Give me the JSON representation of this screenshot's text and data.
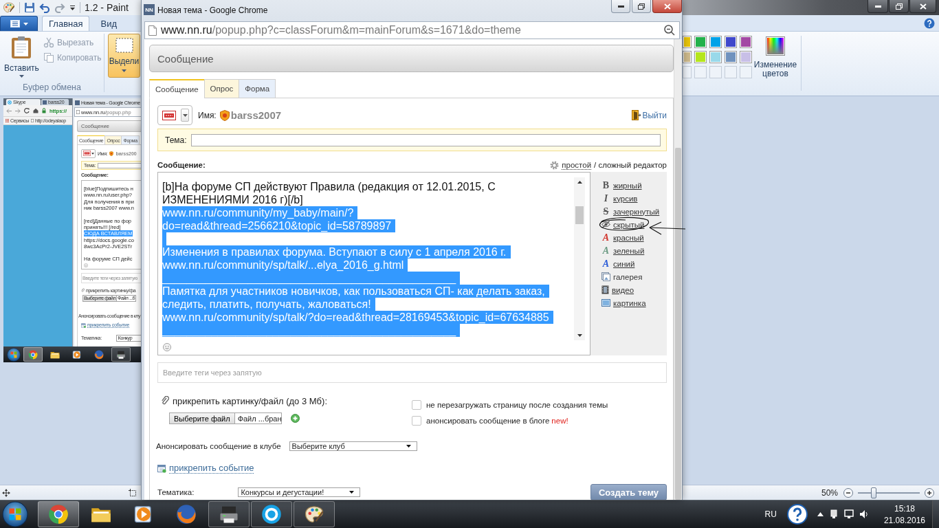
{
  "paint": {
    "title": "1.2 - Paint",
    "tabs": [
      {
        "label": "Главная",
        "selected": true
      },
      {
        "label": "Вид",
        "selected": false
      }
    ],
    "clipboard": {
      "paste": "Вставить",
      "cut": {
        "label": "Вырезать",
        "disabled": true
      },
      "copy": {
        "label": "Копировать",
        "disabled": true
      },
      "group": "Буфер обмена"
    },
    "select_tool": {
      "label": "Выдели",
      "selected": true
    },
    "palette": [
      [
        {
          "kind": "color",
          "color": "#e8c40a"
        },
        {
          "kind": "color",
          "color": "#22b14c"
        },
        {
          "kind": "color",
          "color": "#00a2e8"
        },
        {
          "kind": "color",
          "color": "#3f48cc"
        },
        {
          "kind": "color",
          "color": "#a349a4"
        }
      ],
      [
        {
          "kind": "color",
          "color": "#cdb98c"
        },
        {
          "kind": "color",
          "color": "#b5e61d"
        },
        {
          "kind": "color",
          "color": "#99d9ea"
        },
        {
          "kind": "color",
          "color": "#7092be"
        },
        {
          "kind": "color",
          "color": "#c8bfe7"
        }
      ],
      [
        {
          "kind": "empty"
        },
        {
          "kind": "empty"
        },
        {
          "kind": "empty"
        },
        {
          "kind": "empty"
        },
        {
          "kind": "empty"
        }
      ]
    ],
    "edit_colors": "Изменение цветов",
    "zoom": {
      "label": "50%",
      "level": 0.25
    }
  },
  "pasted_image": {
    "tabs": [
      {
        "label": "Skype",
        "selected": true
      },
      {
        "label": "barss20",
        "selected": false
      }
    ],
    "address": "https://",
    "bookmarks": [
      "Сервисы",
      "http://odeyalaop"
    ],
    "popup": {
      "title": "Новая тема - Google Chrome",
      "url_host": "www.nn.ru",
      "url_path": "/popup.php",
      "header": "Сообщение",
      "tabs": [
        {
          "label": "Сообщение",
          "selected": true,
          "color": "#ffffff"
        },
        {
          "label": "Опрос",
          "selected": false,
          "color": "#fdf6dc"
        },
        {
          "label": "Форма",
          "selected": false,
          "color": "#e7effa"
        }
      ],
      "name_label": "Имя:",
      "user": "barss200",
      "topic_label": "Тема:",
      "message_label": "Сообщение:",
      "lines": [
        {
          "kind": "text",
          "text": "[blue]Подпишитесь н",
          "selected": false
        },
        {
          "kind": "text",
          "text": "www.nn.ru/user.php?",
          "selected": false
        },
        {
          "kind": "text",
          "text": "Для получения в при",
          "selected": false
        },
        {
          "kind": "text",
          "text": "ник barss2007 www.n",
          "selected": false
        },
        {
          "kind": "blank",
          "selected": false
        },
        {
          "kind": "text",
          "text": "[red]Данные по фор",
          "selected": false
        },
        {
          "kind": "text",
          "text": "принять!!! [/red]",
          "selected": false
        },
        {
          "kind": "text",
          "text": "СЮДА ВСТАВЛЯЕМ",
          "selected": true
        },
        {
          "kind": "text",
          "text": "https://docs.google.co",
          "selected": false
        },
        {
          "kind": "text",
          "text": "8wc3AcPr2-JVE2STr",
          "selected": false
        },
        {
          "kind": "blank",
          "selected": false
        },
        {
          "kind": "text",
          "text": "На форуме СП дейс",
          "selected": false
        }
      ],
      "tags_placeholder": "Введите теги через запятую",
      "attach": "прикрепить картинку/фа",
      "file_button": "Выберите файл",
      "file_name": "Файл ...б",
      "club_label": "Анонсировать сообщение в клу",
      "event_link": "прикрепить событие",
      "category_label": "Тематика:",
      "category_value": "Конкур"
    },
    "taskbar": [
      {
        "kind": "chrome",
        "running": true,
        "selected": true
      },
      {
        "kind": "explorer",
        "running": false,
        "selected": false
      },
      {
        "kind": "media",
        "running": false,
        "selected": false
      },
      {
        "kind": "firefox",
        "running": false,
        "selected": false
      },
      {
        "kind": "printer",
        "running": true,
        "selected": false
      }
    ]
  },
  "popup": {
    "logo": "NN",
    "title": "Новая тема - Google Chrome",
    "url_host": "www.nn.ru",
    "url_path": "/popup.php?c=classForum&m=mainForum&s=1671&do=theme",
    "header": "Сообщение",
    "tabs": [
      {
        "label": "Сообщение",
        "selected": true,
        "color": "#ffffff"
      },
      {
        "label": "Опрос",
        "selected": false,
        "color": "#fdf6dc"
      },
      {
        "label": "Форма",
        "selected": false,
        "color": "#e7effa"
      }
    ],
    "name_label": "Имя:",
    "user": "barss2007",
    "logout": "Выйти",
    "topic_label": "Тема:",
    "message_label": "Сообщение:",
    "editor_mode": {
      "simple": "простой",
      "complex": "/ сложный редактор"
    },
    "lines": [
      {
        "kind": "text",
        "text": "[b]На форуме СП действуют Правила (редакция от 12.01.2015, С",
        "selected": false
      },
      {
        "kind": "text",
        "text": "ИЗМЕНЕНИЯМИ 2016 г)[/b]",
        "selected": false
      },
      {
        "kind": "text",
        "text": "www.nn.ru/community/my_baby/main/?",
        "selected": true
      },
      {
        "kind": "text",
        "text": "do=read&thread=2566210&topic_id=58789897",
        "selected": true
      },
      {
        "kind": "blank",
        "selected": true
      },
      {
        "kind": "text",
        "text": "Изменения в правилах форума. Вступают в силу с 1 апреля 2016 г.",
        "selected": true
      },
      {
        "kind": "text",
        "text": "www.nn.ru/community/sp/talk/...elya_2016_g.html",
        "selected": true
      },
      {
        "kind": "text",
        "text": "________________________________________________",
        "selected": true
      },
      {
        "kind": "text",
        "text": "Памятка для участников новичков, как пользоваться СП- как делать заказ,",
        "selected": true
      },
      {
        "kind": "text",
        "text": "следить, платить, получать, жаловаться!",
        "selected": true
      },
      {
        "kind": "text",
        "text": "www.nn.ru/community/sp/talk/?do=read&thread=28169453&topic_id=67634885",
        "selected": true
      },
      {
        "kind": "text",
        "text": "________________________________________________",
        "selected": true
      }
    ],
    "toolbar": [
      {
        "kind": "bold",
        "glyph": "B",
        "label": "жирный",
        "link": true
      },
      {
        "kind": "italic",
        "glyph": "I",
        "label": "курсив",
        "link": true
      },
      {
        "kind": "strike",
        "glyph": "S",
        "label": "зачеркнутый",
        "link": true
      },
      {
        "kind": "hidden",
        "label": "скрытый",
        "link": true
      },
      {
        "kind": "color",
        "glyph": "A",
        "color": "#d0342c",
        "label": "красный",
        "link": true
      },
      {
        "kind": "color",
        "glyph": "A",
        "color": "#6a9a82",
        "label": "зеленый",
        "link": true
      },
      {
        "kind": "color",
        "glyph": "A",
        "color": "#2a5bd7",
        "label": "синий",
        "link": true
      },
      {
        "kind": "gallery",
        "label": "галерея",
        "link": false
      },
      {
        "kind": "video",
        "label": "видео",
        "link": true
      },
      {
        "kind": "image",
        "label": "картинка",
        "link": true
      }
    ],
    "tags_placeholder": "Введите теги через запятую",
    "attach_label": "прикрепить картинку/файл (до 3 Мб):",
    "file_button": "Выберите файл",
    "file_name": "Файл ...бран",
    "options": [
      {
        "label": "не перезагружать страницу после создания темы",
        "checked": false
      },
      {
        "label": "анонсировать сообщение в блоге",
        "badge": "new!",
        "checked": false
      }
    ],
    "club": {
      "label": "Анонсировать сообщение в клубе",
      "value": "Выберите клуб"
    },
    "event_link": "прикрепить событие",
    "category": {
      "label": "Тематика:",
      "value": "Конкурсы и дегустации!"
    },
    "submit": "Создать тему"
  },
  "taskbar": {
    "apps": [
      {
        "kind": "chrome",
        "running": true,
        "selected": true
      },
      {
        "kind": "explorer",
        "running": false,
        "selected": false
      },
      {
        "kind": "media",
        "running": false,
        "selected": false
      },
      {
        "kind": "firefox",
        "running": false,
        "selected": false
      },
      {
        "kind": "printer",
        "running": true,
        "selected": false
      },
      {
        "kind": "skype",
        "running": true,
        "selected": false
      },
      {
        "kind": "paint",
        "running": true,
        "selected": false
      }
    ],
    "language": "RU",
    "time": "15:18",
    "date": "21.08.2016"
  }
}
